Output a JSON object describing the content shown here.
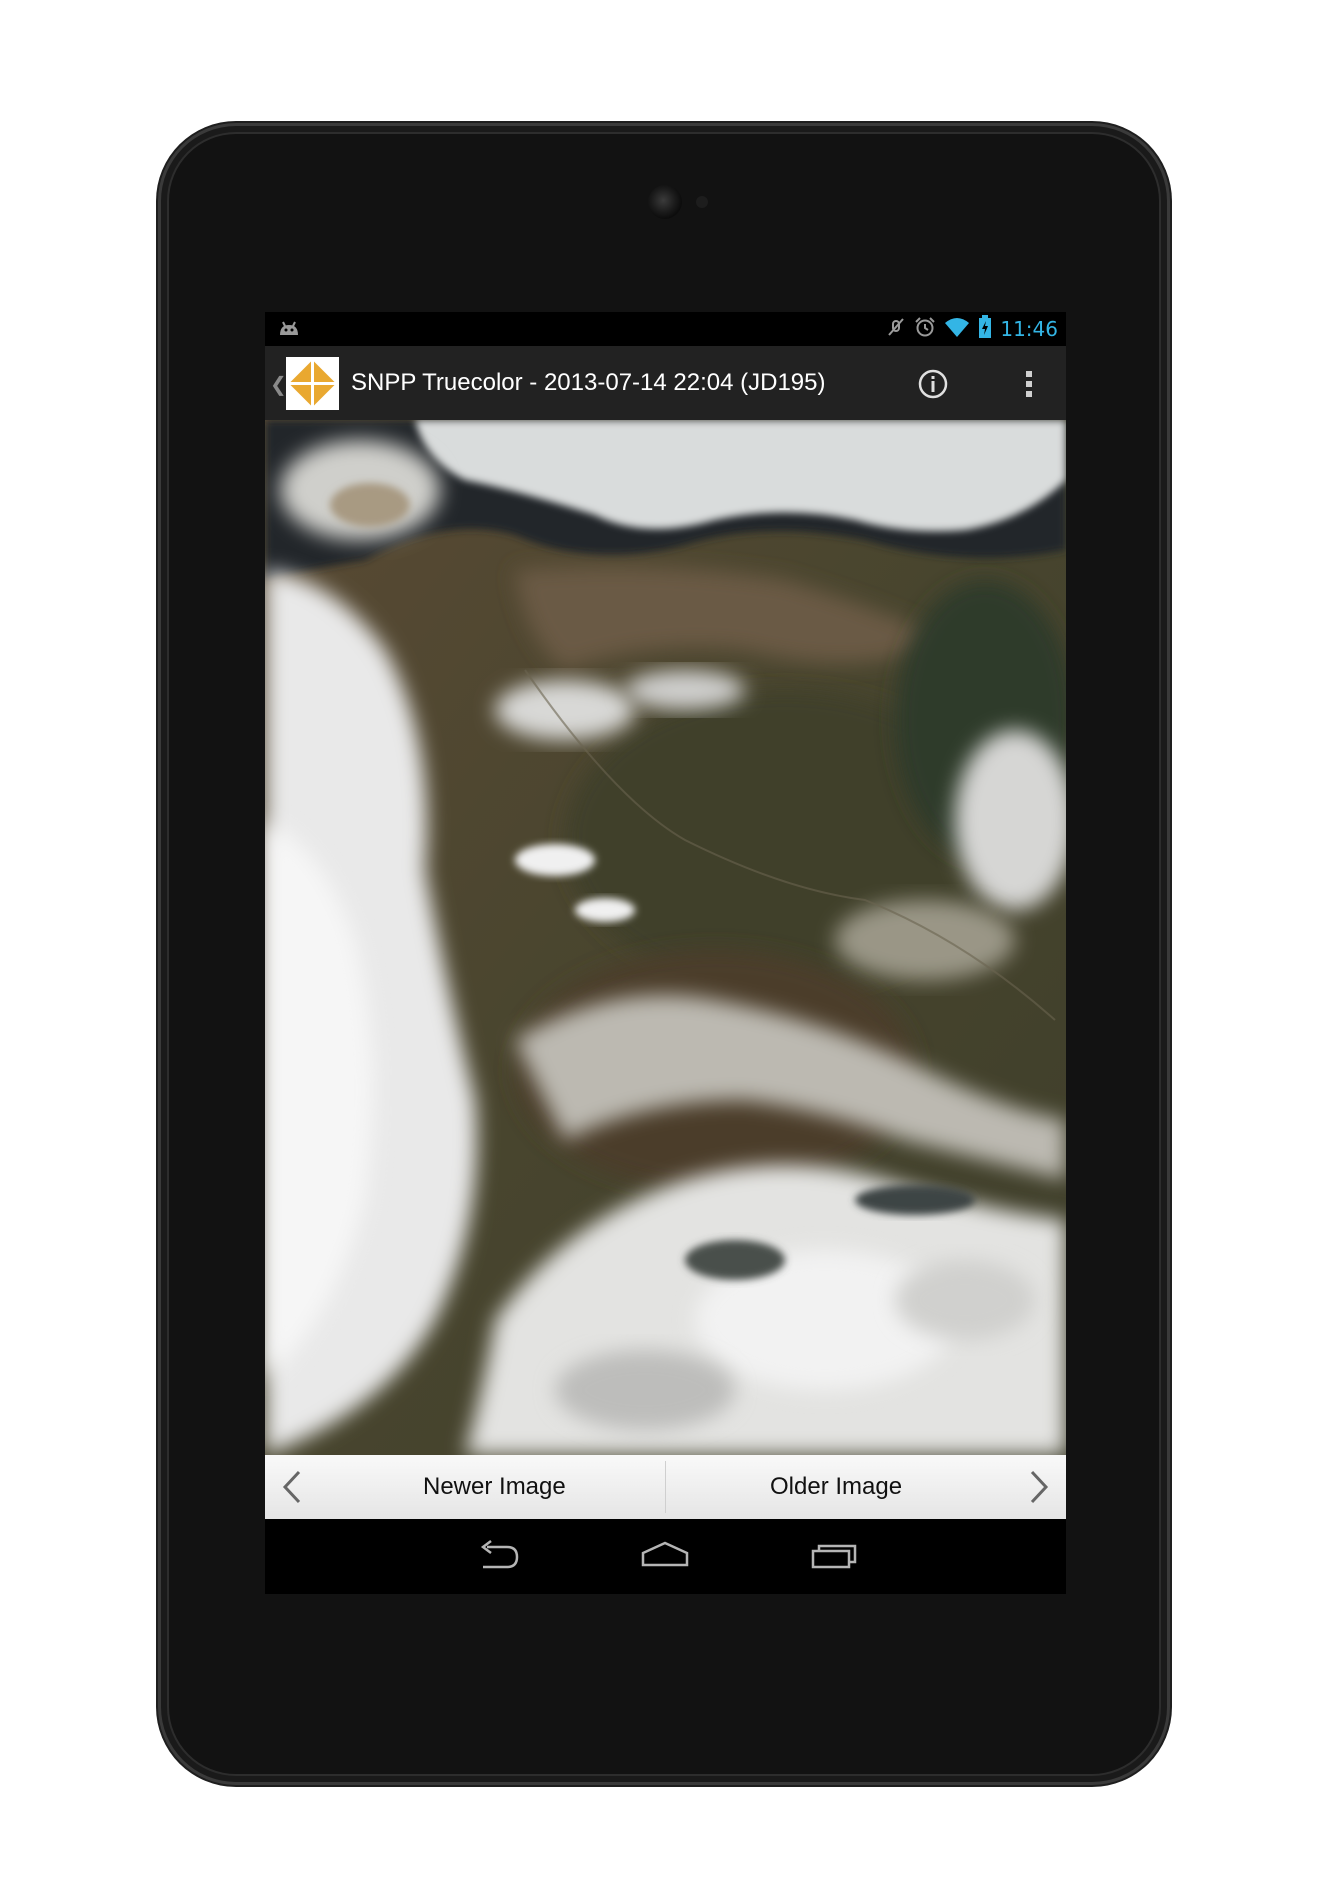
{
  "status_bar": {
    "notification_icon": "android-robot-icon",
    "icons": [
      "mute-icon",
      "alarm-icon",
      "wifi-icon",
      "battery-charging-icon"
    ],
    "time": "11:46",
    "accent_color": "#33b5e5"
  },
  "action_bar": {
    "up_icon": "up-caret-icon",
    "app_icon": "ssec-logo-icon",
    "title": "SNPP Truecolor - 2013-07-14 22:04 (JD195)",
    "actions": [
      "info-icon",
      "overflow-menu-icon"
    ]
  },
  "image": {
    "subject": "satellite-truecolor-image"
  },
  "navigation": {
    "newer_label": "Newer Image",
    "older_label": "Older Image",
    "newer_icon": "chevron-left-icon",
    "older_icon": "chevron-right-icon"
  },
  "system_nav": {
    "buttons": [
      "back-icon",
      "home-icon",
      "recents-icon"
    ]
  },
  "colors": {
    "brand_logo": "#e9a830",
    "action_bar_bg": "#222222",
    "device_body": "#121212"
  }
}
